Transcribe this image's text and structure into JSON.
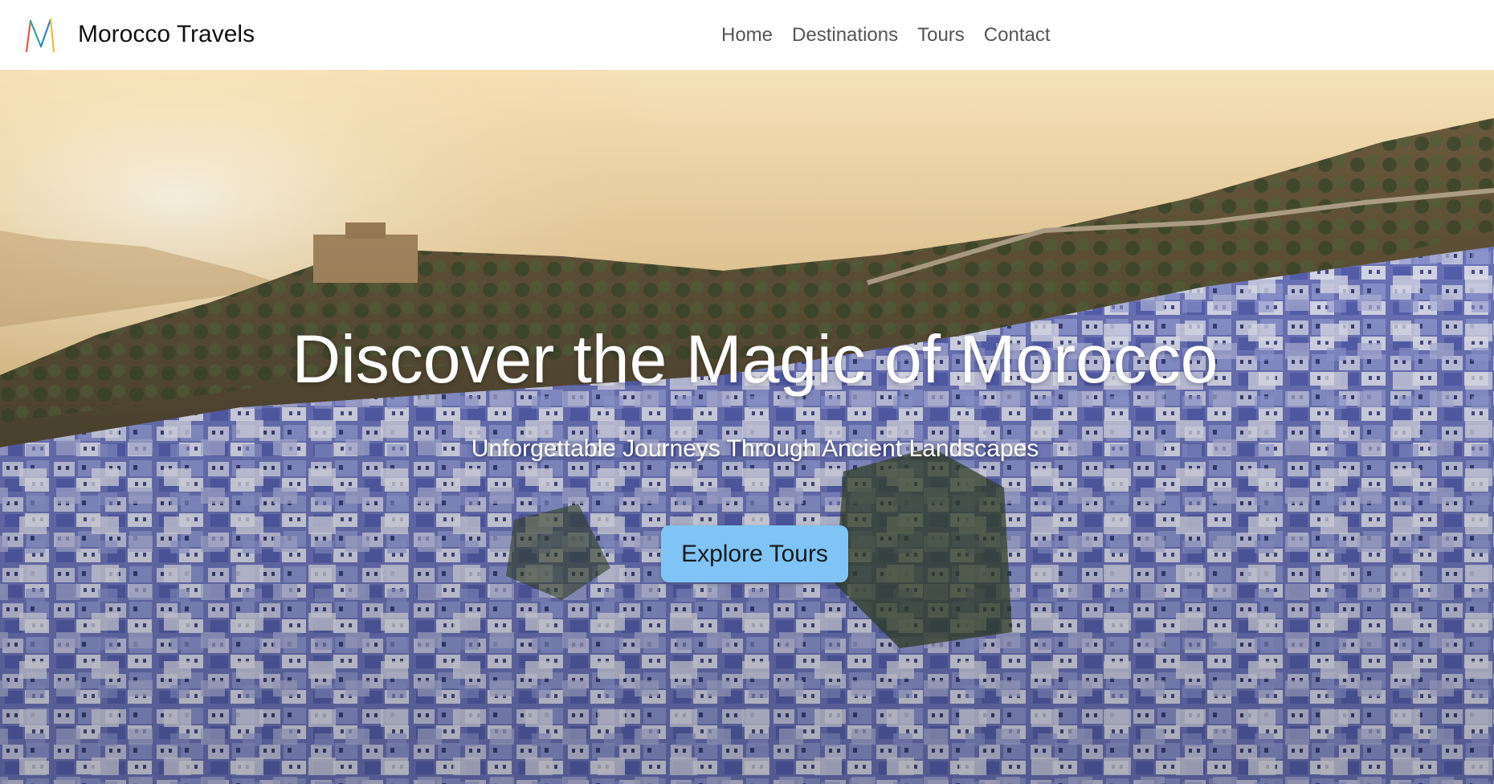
{
  "header": {
    "logo_icon": "m-logo-icon",
    "brand": "Morocco Travels",
    "nav": [
      {
        "label": "Home"
      },
      {
        "label": "Destinations"
      },
      {
        "label": "Tours"
      },
      {
        "label": "Contact"
      }
    ]
  },
  "hero": {
    "background": "chefchaouen-blue-city-photo",
    "title": "Discover the Magic of Morocco",
    "subtitle": "Unforgettable Journeys Through Ancient Landscapes",
    "cta_label": "Explore Tours"
  },
  "colors": {
    "cta": "#7fc4f5",
    "nav_text": "#555555",
    "brand_text": "#111111"
  }
}
